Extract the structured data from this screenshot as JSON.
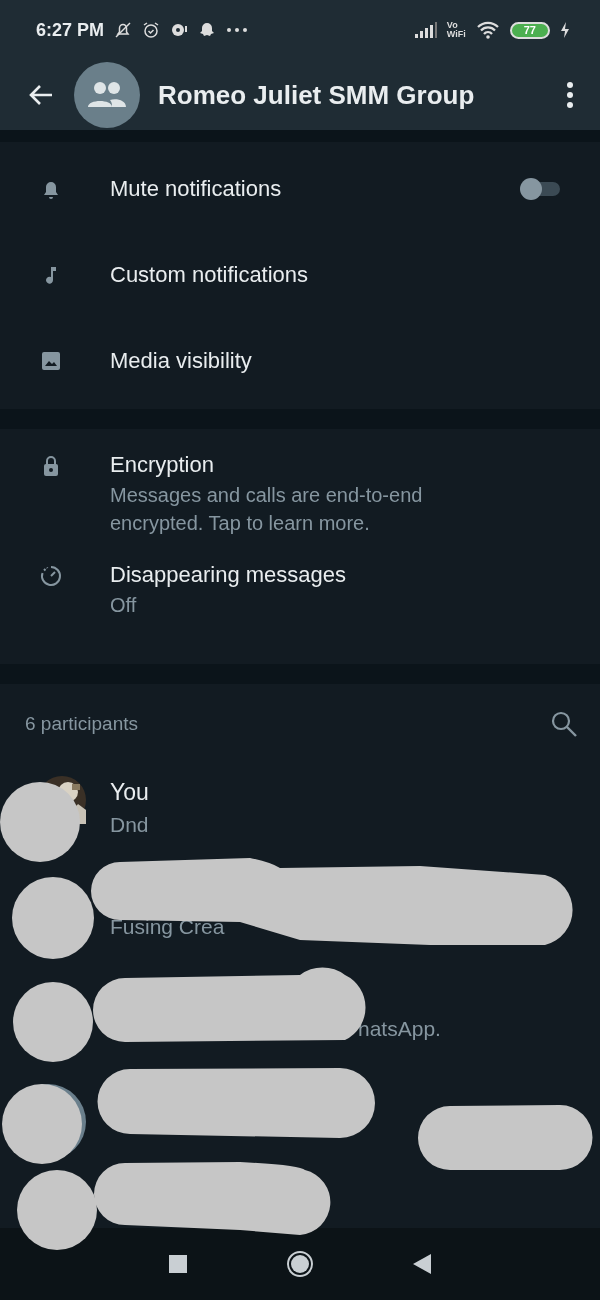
{
  "status_bar": {
    "time": "6:27 PM",
    "network_label": [
      "Vo",
      "WiFi"
    ],
    "battery": "77"
  },
  "header": {
    "title": "Romeo Juliet SMM Group"
  },
  "settings": [
    {
      "kind": "toggle",
      "label": "Mute notifications",
      "on": false
    },
    {
      "kind": "plain",
      "label": "Custom notifications"
    },
    {
      "kind": "plain",
      "label": "Media visibility"
    }
  ],
  "security": [
    {
      "label": "Encryption",
      "subtitle": "Messages and calls are end-to-end encrypted. Tap to learn more."
    },
    {
      "label": "Disappearing messages",
      "subtitle": "Off"
    }
  ],
  "participants": {
    "count_label": "6 participants",
    "members": [
      {
        "kind": "full",
        "name": "You",
        "status": "Dnd"
      },
      {
        "kind": "start",
        "status": "Fusing Crea"
      },
      {
        "kind": "end",
        "status": "hatsApp."
      }
    ]
  }
}
